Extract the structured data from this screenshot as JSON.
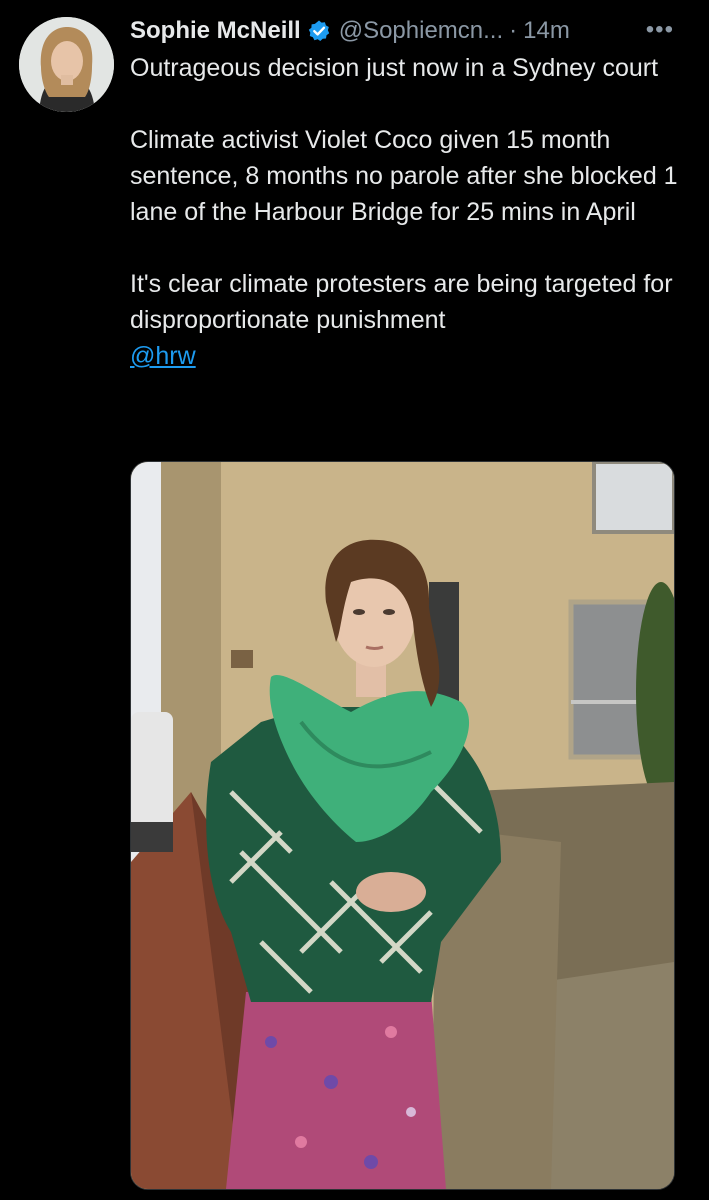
{
  "tweet": {
    "author_name": "Sophie McNeill",
    "handle": "@Sophiemcn...",
    "separator": "·",
    "time": "14m",
    "more_label": "•••",
    "verified_icon": "verified-badge-icon",
    "avatar_icon": "profile-photo",
    "paragraphs": [
      "Outrageous decision just now in a Sydney court",
      "Climate activist Violet Coco given 15 month sentence, 8 months no parole after she blocked 1 lane of the Harbour Bridge for 25 mins in April",
      "It's clear climate protesters are being targeted for disproportionate punishment"
    ],
    "mention": "@hrw",
    "media_icon": "photo-woman-green-scarf",
    "colors": {
      "background": "#000000",
      "text": "#e7e9ea",
      "secondary": "#8b98a5",
      "accent": "#1d9bf0"
    }
  }
}
